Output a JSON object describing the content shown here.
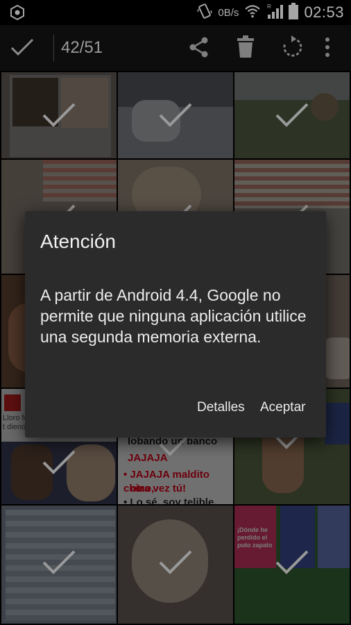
{
  "status_bar": {
    "net_speed": "0B/s",
    "clock": "02:53"
  },
  "action_bar": {
    "selection_count": "42/51"
  },
  "dialog": {
    "title": "Atención",
    "message": "A partir de Android 4.4, Google no permite que ninguna aplicación utilice una segunda memoria externa.",
    "buttons": {
      "details": "Detalles",
      "accept": "Aceptar"
    }
  },
  "tiles_text": {
    "line1": "lobando un banco",
    "line2": "JAJAJA",
    "line3": "• JAJAJA maldito chino,",
    "line4": "otra vez tú!",
    "line5": "• Lo sé, soy telible.",
    "label_left": "Lloro fo",
    "label_left2": "t dieno",
    "label_right": "¡Dónde he perdido el puto zapato"
  },
  "colors": {
    "dialog_bg": "#2b2b2b",
    "accent_red": "#e0001b"
  }
}
